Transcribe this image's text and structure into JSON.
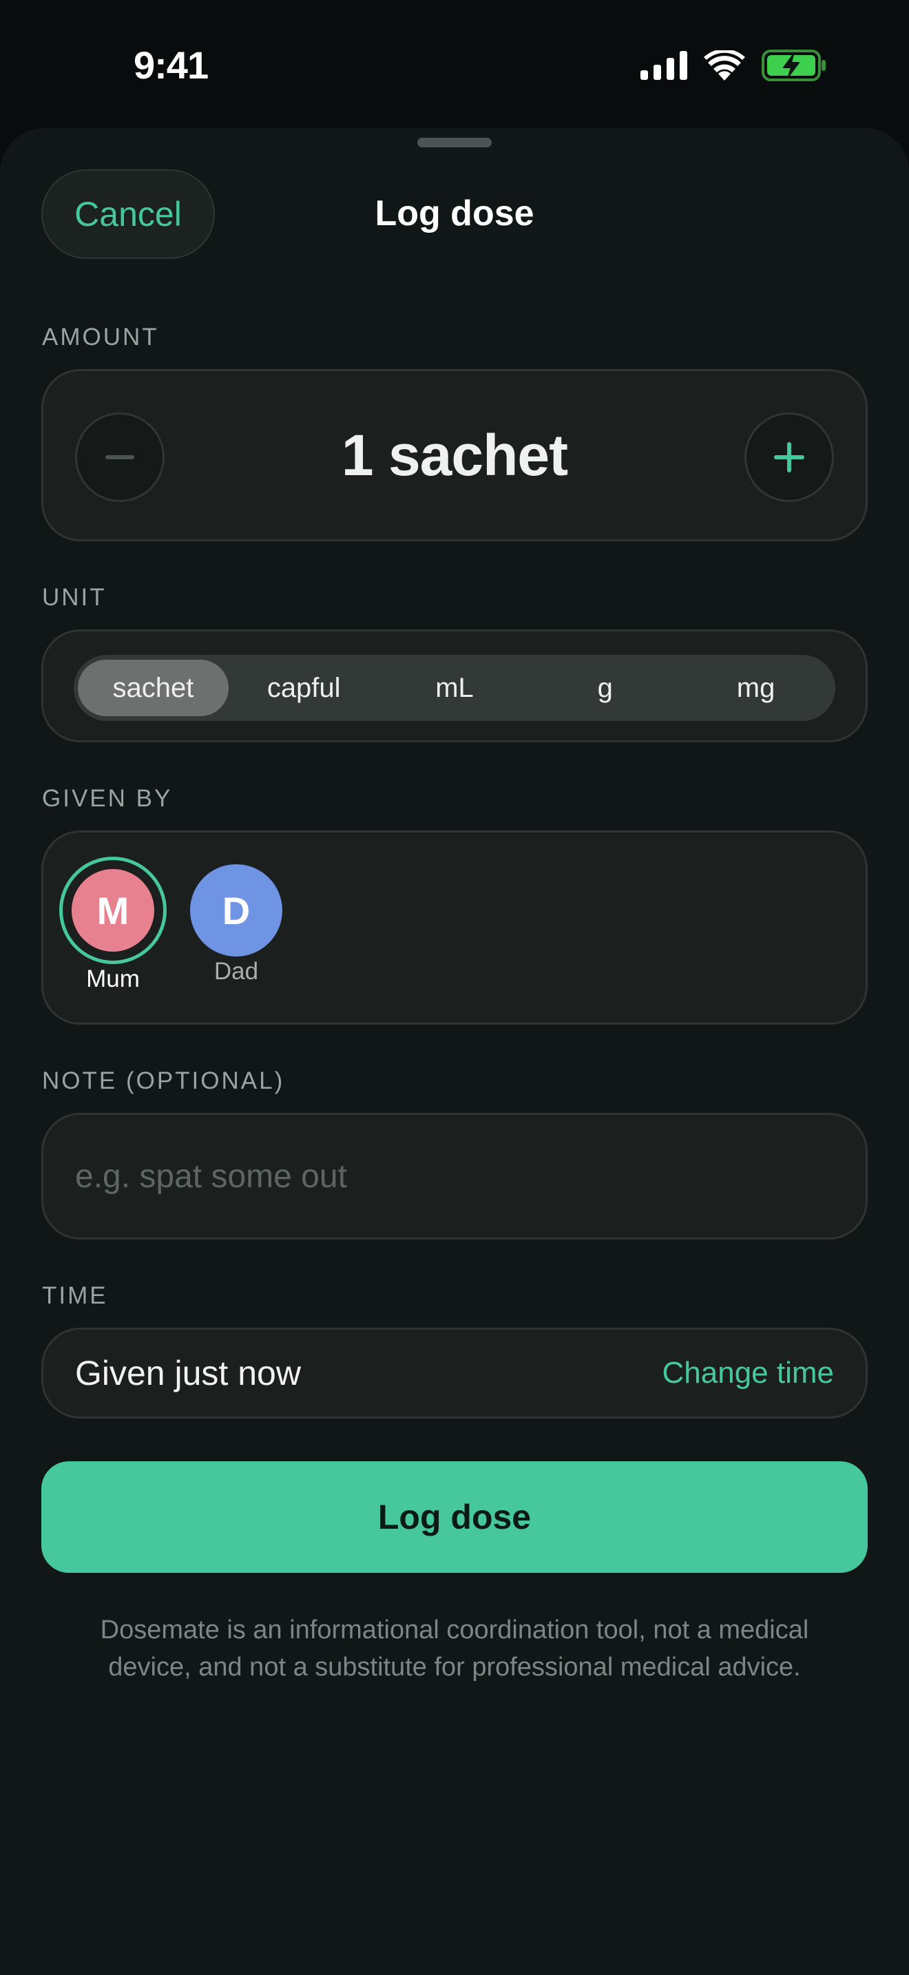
{
  "status_bar": {
    "time": "9:41"
  },
  "sheet": {
    "title": "Log dose",
    "cancel_label": "Cancel"
  },
  "amount": {
    "label": "AMOUNT",
    "value": "1 sachet",
    "minus_icon": "minus-icon",
    "plus_icon": "plus-icon"
  },
  "unit": {
    "label": "UNIT",
    "options": [
      "sachet",
      "capful",
      "mL",
      "g",
      "mg"
    ],
    "selected": "sachet"
  },
  "given_by": {
    "label": "GIVEN BY",
    "people": [
      {
        "initial": "M",
        "name": "Mum",
        "color": "#e7818f",
        "selected": true
      },
      {
        "initial": "D",
        "name": "Dad",
        "color": "#6f94e4",
        "selected": false
      }
    ]
  },
  "note": {
    "label": "NOTE (OPTIONAL)",
    "placeholder": "e.g. spat some out",
    "value": ""
  },
  "time": {
    "label": "TIME",
    "value": "Given just now",
    "change_label": "Change time"
  },
  "primary_action": {
    "label": "Log dose"
  },
  "disclaimer": "Dosemate is an informational coordination tool, not a medical device, and not a substitute for professional medical advice.",
  "colors": {
    "accent": "#46c79c",
    "background": "#111716",
    "card": "#1b201e"
  }
}
